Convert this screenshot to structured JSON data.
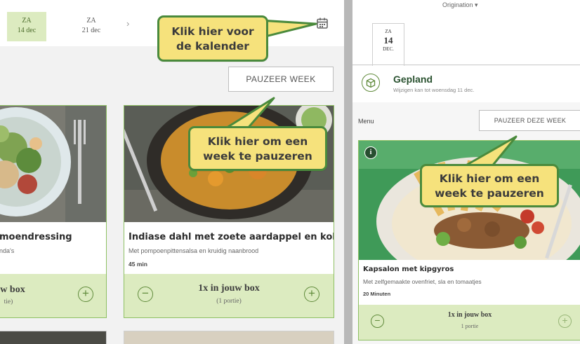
{
  "left_panel": {
    "dates": [
      {
        "day": "ZA",
        "date": "14 dec",
        "selected": true
      },
      {
        "day": "ZA",
        "date": "21 dec",
        "selected": false
      }
    ],
    "next_arrow": "›",
    "pause_button": "PAUZEER WEEK",
    "recipes": [
      {
        "title": "moendressing",
        "subtitle": "nda's",
        "box_text": "w box",
        "portion": "tie)"
      },
      {
        "title": "Indiase dahl met zoete aardappel en kokos...",
        "subtitle": "Met pompoenpittensalsa en kruidig naanbrood",
        "time": "45 min",
        "box_text": "1x in jouw box",
        "portion": "(1 portie)"
      }
    ]
  },
  "right_panel": {
    "origin_selector": "Origination ▾",
    "tab": {
      "day": "ZA",
      "date": "14",
      "month": "DEC."
    },
    "status_title": "Gepland",
    "status_sub": "Wijzigen kan tot woensdag 11 dec.",
    "menu_label": "Menu",
    "pause_button": "PAUZEER DEZE WEEK",
    "recipe": {
      "info_label": "i",
      "title": "Kapsalon met kipgyros",
      "subtitle": "Met zelfgemaakte ovenfriet, sla en tomaatjes",
      "time": "20 Minuten",
      "box_text": "1x in jouw box",
      "portion": "1 portie"
    }
  },
  "callouts": {
    "calendar": [
      "Klik hier voor",
      "de kalender"
    ],
    "pause_left": [
      "Klik hier om een",
      "week te pauzeren"
    ],
    "pause_right": [
      "Klik hier om een",
      "week te pauzeren"
    ]
  },
  "colors": {
    "accent_green": "#8ec063",
    "light_green": "#dcebc0",
    "callout_yellow": "#f6e27c",
    "callout_border": "#4a8a3c"
  }
}
